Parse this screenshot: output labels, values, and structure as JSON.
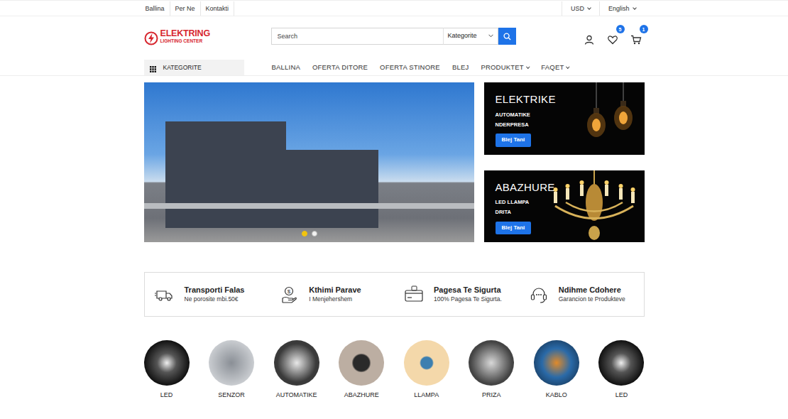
{
  "topbar": {
    "links": [
      "Ballina",
      "Per Ne",
      "Kontakti"
    ],
    "currency": {
      "label": "USD",
      "dropdown": true
    },
    "language": {
      "label": "English",
      "dropdown": true
    }
  },
  "header": {
    "logo": {
      "name": "ELEKTRING",
      "tagline": "LIGHTING CENTER"
    },
    "search": {
      "placeholder": "Search",
      "category": "Kategorite"
    },
    "wishlist_count": "5",
    "cart_count": "1"
  },
  "nav": {
    "categories_label": "KATEGORITE",
    "items": [
      {
        "label": "BALLINA",
        "dropdown": false
      },
      {
        "label": "OFERTA DITORE",
        "dropdown": false
      },
      {
        "label": "OFERTA STINORE",
        "dropdown": false
      },
      {
        "label": "BLEJ",
        "dropdown": false
      },
      {
        "label": "PRODUKTET",
        "dropdown": true
      },
      {
        "label": "FAQET",
        "dropdown": true
      }
    ]
  },
  "hero": {
    "dots": [
      {
        "selected": true
      },
      {
        "selected": false
      }
    ]
  },
  "banners": [
    {
      "title": "ELEKTRIKE",
      "lines": [
        "AUTOMATIKE",
        "NDERPRESA"
      ],
      "button": "Blej Tani",
      "kind": "bulbs"
    },
    {
      "title": "ABAZHURE",
      "lines": [
        "LED LLAMPA",
        "DRITA"
      ],
      "button": "Blej Tani",
      "kind": "chandelier"
    }
  ],
  "features": [
    {
      "title": "Transporti Falas",
      "subtitle": "Ne porosite mbi.50€",
      "kind": "truck"
    },
    {
      "title": "Kthimi Parave",
      "subtitle": "I Menjehershem",
      "kind": "money"
    },
    {
      "title": "Pagesa Te Sigurta",
      "subtitle": "100% Pagesa Te Sigurta.",
      "kind": "card"
    },
    {
      "title": "Ndihme Cdohere",
      "subtitle": "Garancion te Produkteve",
      "kind": "support"
    }
  ],
  "categories": [
    {
      "label": "LED"
    },
    {
      "label": "SENZOR"
    },
    {
      "label": "AUTOMATIKE"
    },
    {
      "label": "ABAZHURE"
    },
    {
      "label": "LLAMPA"
    },
    {
      "label": "PRIZA"
    },
    {
      "label": "KABLO"
    },
    {
      "label": "LED"
    }
  ]
}
